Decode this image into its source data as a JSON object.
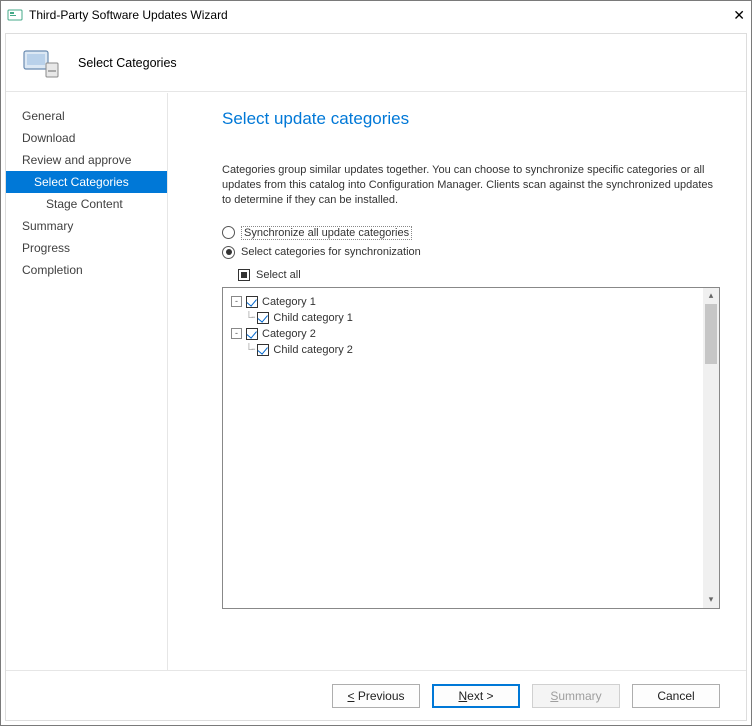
{
  "window": {
    "title": "Third-Party Software Updates Wizard",
    "close_glyph": "✕"
  },
  "banner": {
    "title": "Select Categories"
  },
  "sidebar": {
    "items": [
      {
        "label": "General",
        "indent": 0,
        "selected": false
      },
      {
        "label": "Download",
        "indent": 0,
        "selected": false
      },
      {
        "label": "Review and approve",
        "indent": 0,
        "selected": false
      },
      {
        "label": "Select Categories",
        "indent": 1,
        "selected": true
      },
      {
        "label": "Stage Content",
        "indent": 2,
        "selected": false
      },
      {
        "label": "Summary",
        "indent": 0,
        "selected": false
      },
      {
        "label": "Progress",
        "indent": 0,
        "selected": false
      },
      {
        "label": "Completion",
        "indent": 0,
        "selected": false
      }
    ]
  },
  "content": {
    "heading": "Select update categories",
    "description": "Categories group similar updates together. You can choose to synchronize specific categories or all updates from this catalog into Configuration Manager. Clients scan against the synchronized updates to determine if they can be installed.",
    "radio_sync_all": "Synchronize all update categories",
    "radio_sync_all_selected": false,
    "radio_select_categories": "Select categories for synchronization",
    "radio_select_categories_selected": true,
    "select_all_label": "Select all",
    "tree": [
      {
        "level": 0,
        "expander": "-",
        "checked": true,
        "label": "Category 1"
      },
      {
        "level": 1,
        "expander": "",
        "checked": true,
        "label": "Child category 1"
      },
      {
        "level": 0,
        "expander": "-",
        "checked": true,
        "label": "Category 2"
      },
      {
        "level": 1,
        "expander": "",
        "checked": true,
        "label": "Child category 2"
      }
    ]
  },
  "footer": {
    "previous": "< Previous",
    "next": "Next >",
    "summary": "Summary",
    "cancel": "Cancel"
  }
}
